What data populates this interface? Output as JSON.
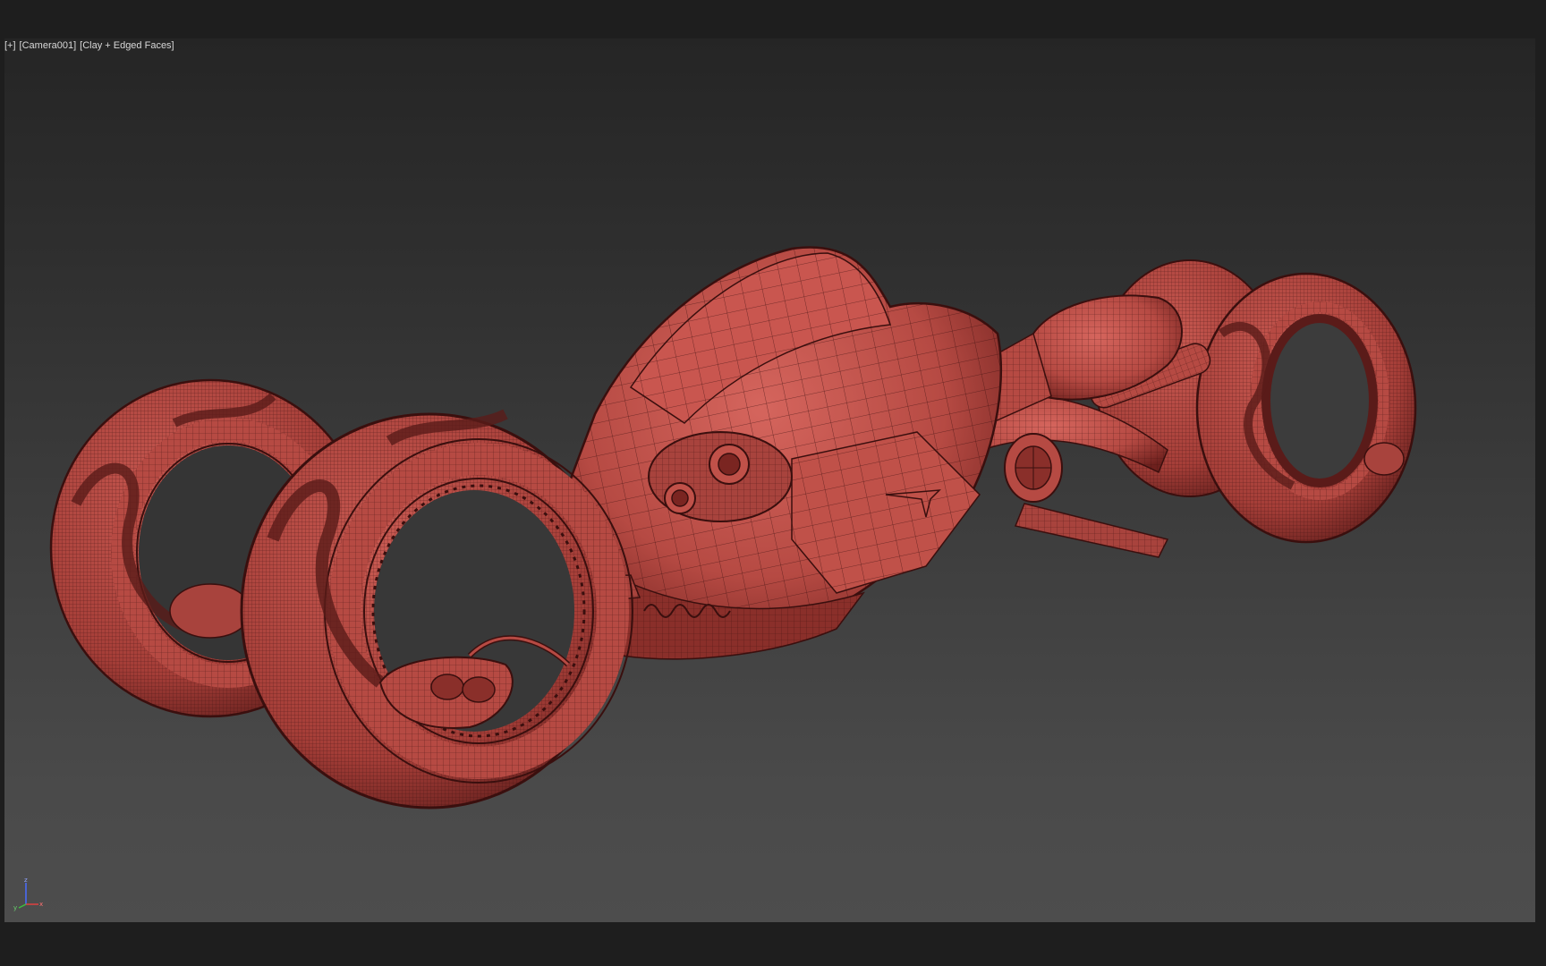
{
  "viewport": {
    "plus_menu": "[+]",
    "camera_menu": "[Camera001]",
    "shading_menu": "[Clay + Edged Faces]"
  },
  "axis_gizmo": {
    "z_label": "z",
    "x_label": "x",
    "y_label": "y"
  },
  "colors": {
    "app_background": "#1e1e1e",
    "viewport_top": "#252525",
    "viewport_bottom": "#4d4d4d",
    "clay_base": "#b64a43",
    "clay_dark": "#5a1b19",
    "wire_edge": "#3a0f0e"
  },
  "model": {
    "icon": "trike-vehicle-wireframe"
  }
}
